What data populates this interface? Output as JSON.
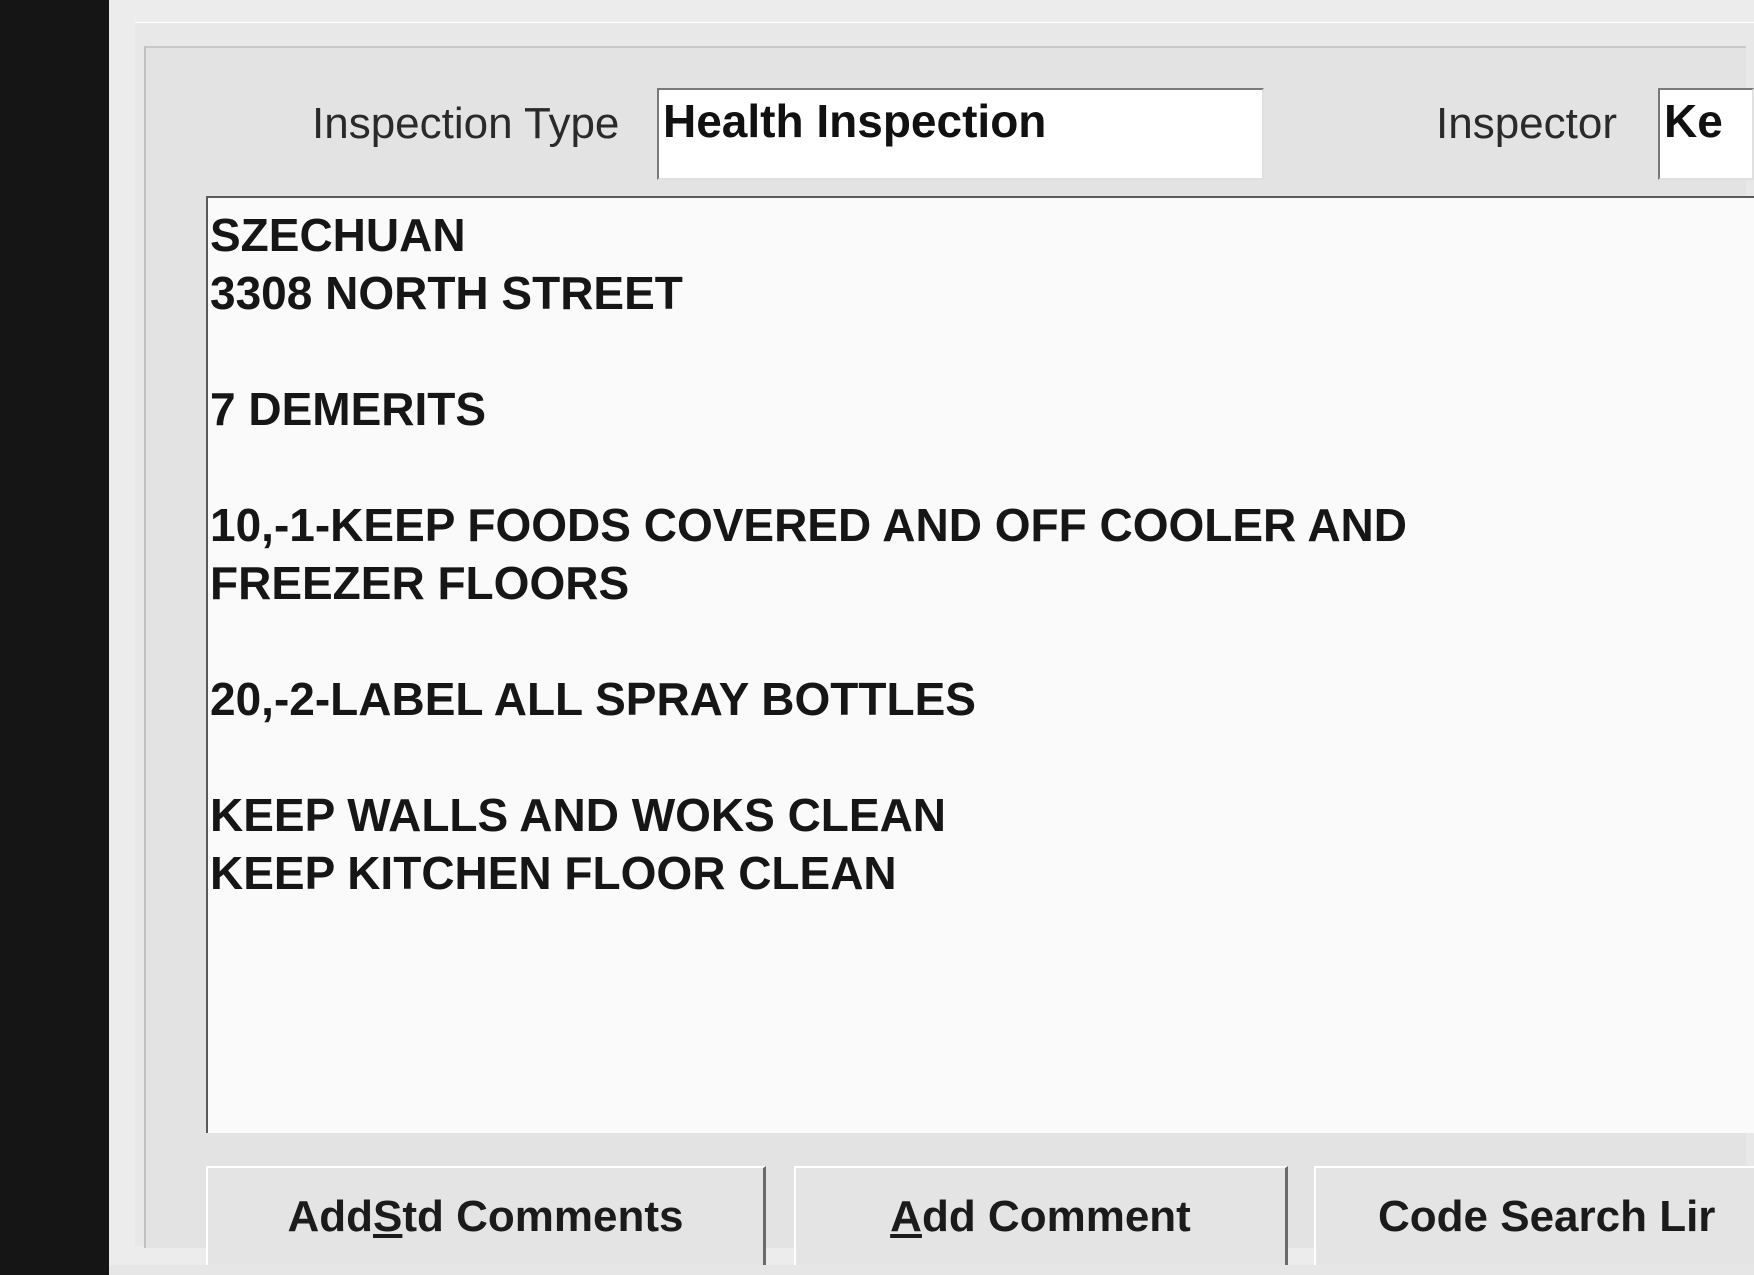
{
  "header": {
    "inspection_type_label": "Inspection Type",
    "inspection_type_value": "Health Inspection",
    "inspector_label": "Inspector",
    "inspector_value": "Ke"
  },
  "comments": {
    "lines": [
      "SZECHUAN",
      "3308 NORTH STREET",
      "",
      "7 DEMERITS",
      "",
      "10,-1-KEEP FOODS COVERED AND OFF COOLER AND",
      "FREEZER FLOORS",
      "",
      "20,-2-LABEL ALL SPRAY BOTTLES",
      "",
      "KEEP WALLS AND WOKS CLEAN",
      "KEEP KITCHEN FLOOR CLEAN"
    ]
  },
  "buttons": {
    "add_std_comments": {
      "pre": "Add ",
      "mnemonic": "S",
      "post": "td Comments"
    },
    "add_comment": {
      "pre": "",
      "mnemonic": "A",
      "post": "dd Comment"
    },
    "code_search": {
      "label": "Code Search Lir"
    }
  },
  "colors": {
    "window_bg": "#ececec",
    "input_bg": "#ffffff",
    "text": "#161616",
    "scan_border": "#151515"
  }
}
